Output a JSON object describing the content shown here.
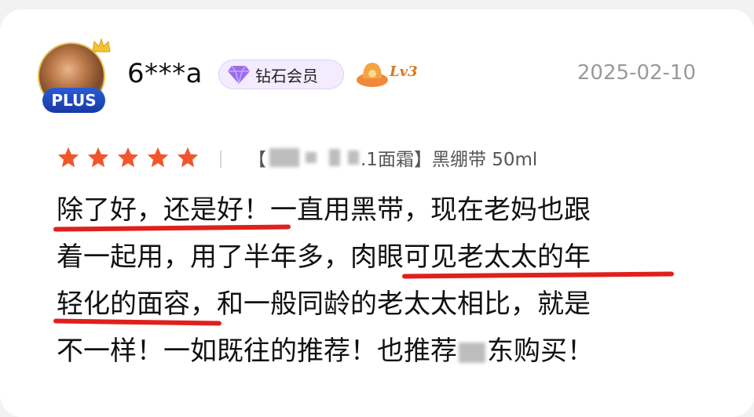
{
  "user": {
    "name": "6***a",
    "plus_label": "PLUS",
    "member_label": "钻石会员",
    "level_label": "Lv3"
  },
  "review_date": "2025-02-10",
  "rating": 5,
  "product": {
    "prefix": "【",
    "name_suffix": ".1面霜】黑绷带 50ml"
  },
  "review_lines": [
    "除了好，还是好！一直用黑带，现在老妈也跟",
    "着一起用，用了半年多，肉眼可见老太太的年",
    "轻化的面容，和一般同龄的老太太相比，就是",
    "不一样！一如既往的推荐！也推荐",
    "东购买！"
  ],
  "colors": {
    "star": "#f2552c",
    "underline": "#e0201c",
    "date": "#9a9a9a",
    "plus_badge": "#1f4cc0"
  }
}
